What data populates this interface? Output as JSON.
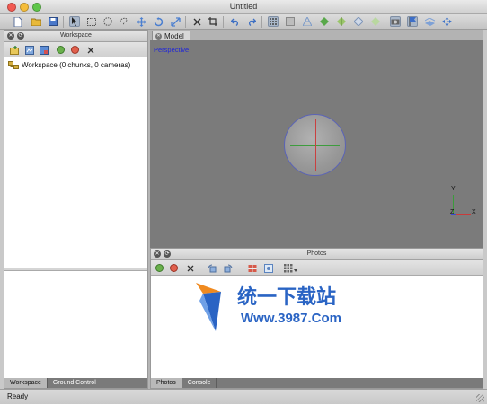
{
  "window": {
    "title": "Untitled"
  },
  "colors": {
    "accent_blue": "#2026d8",
    "viewport_bg": "#7b7b7b",
    "x_axis": "#c93a3a",
    "y_axis": "#3b9c3b",
    "z_axis": "#3b4ccf",
    "watermark": "#2a64c4"
  },
  "toolbar": {
    "icons": [
      "new-document-icon",
      "open-folder-icon",
      "save-disk-icon",
      "pointer-icon",
      "rectangle-select-icon",
      "circle-select-icon",
      "free-select-icon",
      "move-object-icon",
      "rotate-object-icon",
      "resize-object-icon",
      "delete-icon",
      "crop-icon",
      "undo-icon",
      "redo-icon",
      "show-points-icon",
      "dense-cloud-icon",
      "mesh-icon",
      "solid-shading-icon",
      "textured-shading-icon",
      "wireframe-icon",
      "normals-icon",
      "show-cameras-icon",
      "show-markers-icon",
      "region-icon",
      "navigation-icon"
    ]
  },
  "workspace": {
    "title": "Workspace",
    "tool_icons": [
      "add-chunk-icon",
      "add-photos-icon",
      "add-folder-icon",
      "enable-icon",
      "disable-icon",
      "remove-icon"
    ],
    "tree_item": "Workspace (0 chunks, 0 cameras)",
    "tabs": [
      "Workspace",
      "Ground Control"
    ]
  },
  "model": {
    "tab_label": "Model",
    "view_label": "Perspective",
    "axis_labels": {
      "x": "X",
      "y": "Y",
      "z": "Z"
    }
  },
  "photos": {
    "title": "Photos",
    "tool_icons": [
      "enable-icon",
      "disable-icon",
      "remove-icon",
      "rotate-left-icon",
      "rotate-right-icon",
      "mask-icon",
      "view-icon",
      "thumbnail-view-icon"
    ],
    "tabs": [
      "Photos",
      "Console"
    ]
  },
  "watermark": {
    "line1": "统一下载站",
    "line2": "Www.3987.Com"
  },
  "status": {
    "text": "Ready"
  }
}
